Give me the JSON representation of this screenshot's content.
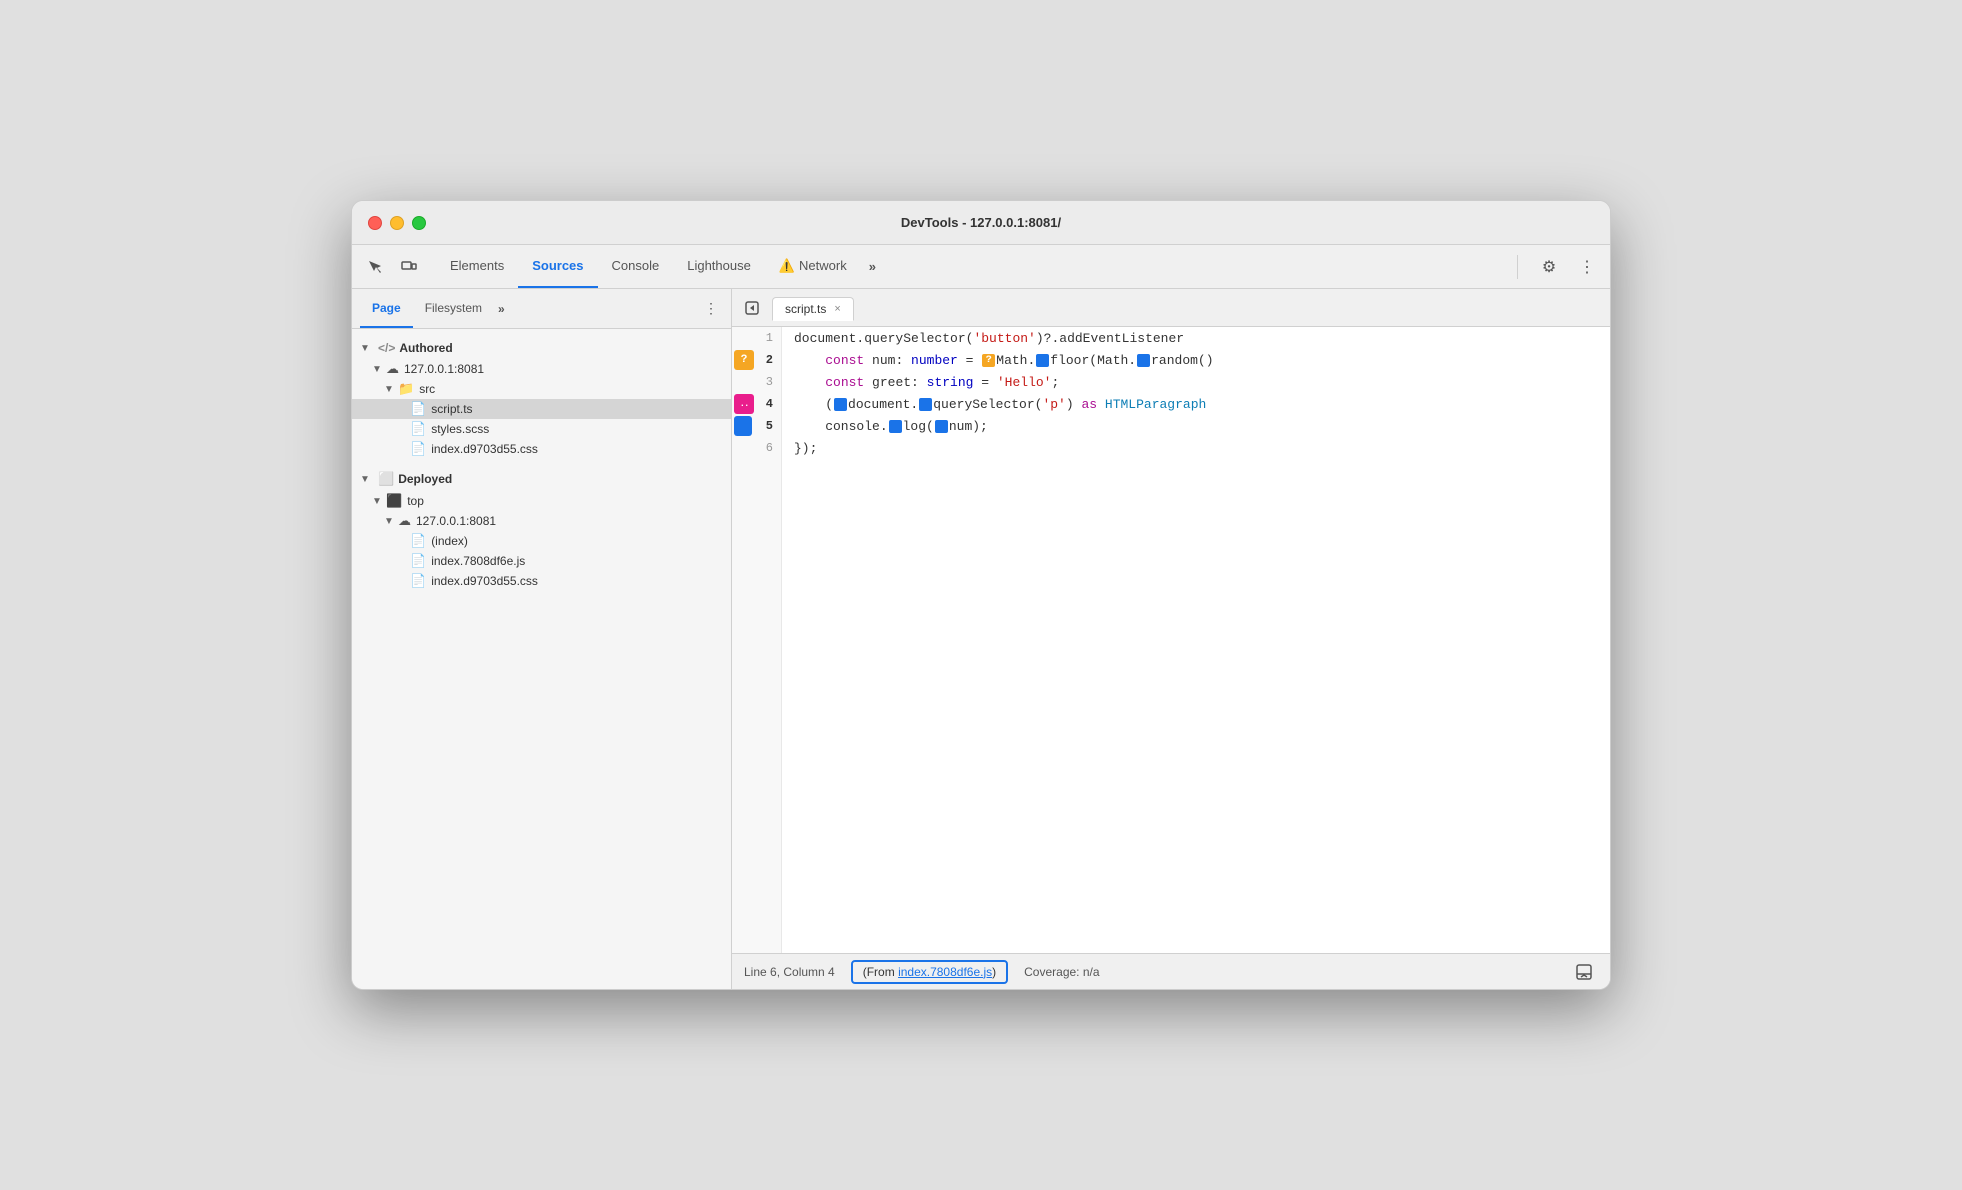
{
  "window": {
    "title": "DevTools - 127.0.0.1:8081/"
  },
  "toolbar": {
    "tabs": [
      {
        "id": "elements",
        "label": "Elements",
        "active": false,
        "warning": false
      },
      {
        "id": "sources",
        "label": "Sources",
        "active": true,
        "warning": false
      },
      {
        "id": "console",
        "label": "Console",
        "active": false,
        "warning": false
      },
      {
        "id": "lighthouse",
        "label": "Lighthouse",
        "active": false,
        "warning": false
      },
      {
        "id": "network",
        "label": "Network",
        "active": false,
        "warning": true
      }
    ],
    "more_label": "»",
    "more_tabs_label": "»"
  },
  "sidebar": {
    "tabs": [
      {
        "id": "page",
        "label": "Page",
        "active": true
      },
      {
        "id": "filesystem",
        "label": "Filesystem",
        "active": false
      }
    ],
    "more_label": "»",
    "sections": {
      "authored": {
        "label": "Authored",
        "children": {
          "server1": {
            "label": "127.0.0.1:8081",
            "children": {
              "src": {
                "label": "src",
                "children": {
                  "scriptts": {
                    "label": "script.ts",
                    "selected": true
                  },
                  "stylesscss": {
                    "label": "styles.scss"
                  },
                  "indexcss": {
                    "label": "index.d9703d55.css"
                  }
                }
              }
            }
          }
        }
      },
      "deployed": {
        "label": "Deployed",
        "children": {
          "top": {
            "label": "top",
            "children": {
              "server2": {
                "label": "127.0.0.1:8081",
                "children": {
                  "index": {
                    "label": "(index)"
                  },
                  "indexjs": {
                    "label": "index.7808df6e.js"
                  },
                  "indexcss2": {
                    "label": "index.d9703d55.css"
                  }
                }
              }
            }
          }
        }
      }
    }
  },
  "editor": {
    "active_file": "script.ts",
    "close_label": "×",
    "lines": [
      {
        "num": 1,
        "badge": null,
        "content": "document.querySelector('button')?.addEventListener"
      },
      {
        "num": 2,
        "badge": "?",
        "badge_color": "orange",
        "content_html": true,
        "content": "    const num: number = ■Math.□floor(Math.□random()"
      },
      {
        "num": 3,
        "badge": null,
        "content": "    const greet: string = 'Hello';"
      },
      {
        "num": 4,
        "badge": "..",
        "badge_color": "pink",
        "content_html": true,
        "content": "    (■document.□querySelector('p') as HTMLParagraph"
      },
      {
        "num": 5,
        "badge": "",
        "badge_color": "blue",
        "content_html": true,
        "content": "    console.□log(□num);"
      },
      {
        "num": 6,
        "badge": null,
        "content": "});"
      }
    ]
  },
  "statusbar": {
    "position": "Line 6, Column 4",
    "source_prefix": "(From ",
    "source_file": "index.7808df6e.js",
    "source_suffix": ")",
    "coverage": "Coverage: n/a"
  }
}
